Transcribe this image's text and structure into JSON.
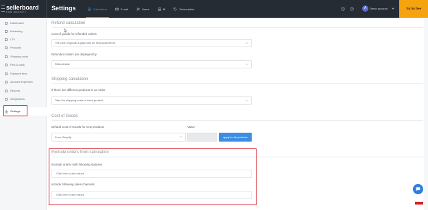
{
  "topbar": {
    "logo_main": "sellerboard",
    "logo_sub": "FOR SHOPIFY",
    "page_title": "Settings",
    "tabs": [
      {
        "label": "Calculation",
        "icon": "calculator-icon",
        "active": true
      },
      {
        "label": "E-mail",
        "icon": "email-icon",
        "active": false
      },
      {
        "label": "Users",
        "icon": "users-icon",
        "active": false
      },
      {
        "label": "BI",
        "icon": "bi-icon",
        "active": false
      },
      {
        "label": "Subscription",
        "icon": "tag-icon",
        "active": false
      }
    ],
    "account_label": "Demo account",
    "try_button": "Try for free"
  },
  "sidebar": {
    "items": [
      {
        "label": "Dashboard",
        "icon": "dashboard-icon"
      },
      {
        "label": "Marketing",
        "icon": "megaphone-icon"
      },
      {
        "label": "LTV",
        "icon": "chart-icon"
      },
      {
        "label": "Products",
        "icon": "box-icon"
      },
      {
        "label": "Shipping costs",
        "icon": "truck-icon"
      },
      {
        "label": "Pick & pack",
        "icon": "package-icon"
      },
      {
        "label": "Payment fees",
        "icon": "card-icon"
      },
      {
        "label": "Account expenses",
        "icon": "wallet-icon"
      },
      {
        "label": "Reports",
        "icon": "report-icon"
      },
      {
        "label": "Integrations",
        "icon": "plug-icon"
      },
      {
        "label": "Settings",
        "icon": "gear-icon",
        "active": true
      }
    ]
  },
  "refund": {
    "section_title": "Refund calculation",
    "cogs_label": "Cost of goods for refunded orders",
    "cogs_value": "The cost of goods is paid only for restocked items",
    "display_label": "Refunded orders are displayed by",
    "display_value": "Refund date"
  },
  "shipping": {
    "section_title": "Shipping calculation",
    "label": "If there are different products in an order",
    "value": "Take the shipping costs of each product"
  },
  "cogs": {
    "section_title": "Cost of Goods",
    "default_label": "Default Cost of Goods for new products",
    "default_value": "From Shopify",
    "value_label": "Value",
    "apply_button": "apply to all products"
  },
  "exclude": {
    "section_title": "Exclude orders from calculation",
    "statuses_label": "Exclude orders with following statuses",
    "statuses_placeholder": "Click here to add values",
    "channels_label": "Include following sales channels",
    "channels_placeholder": "Click here to add values"
  },
  "colors": {
    "topbar": "#262c33",
    "accent": "#3fa0e6",
    "try_button": "#f5a40f",
    "highlight": "#d31f2b",
    "apply_button": "#3c8de5"
  }
}
